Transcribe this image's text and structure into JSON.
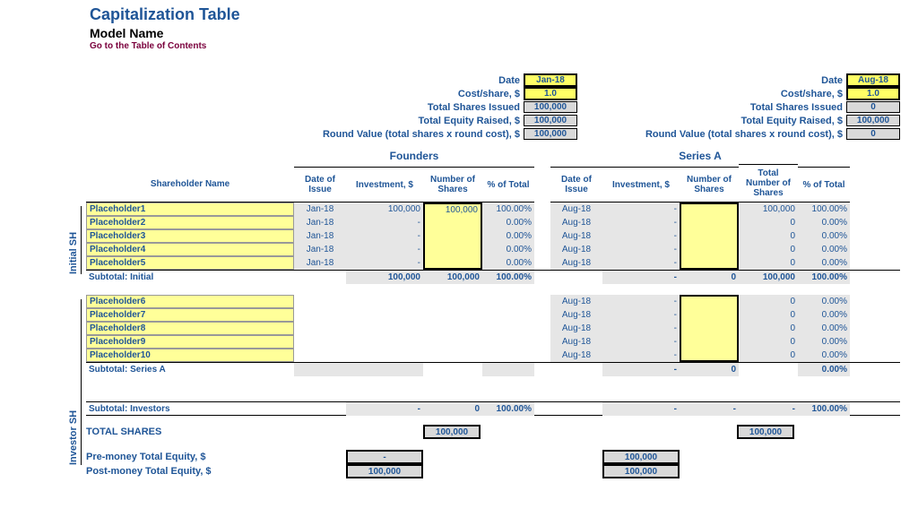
{
  "header": {
    "title": "Capitalization Table",
    "subtitle": "Model Name",
    "toc": "Go to the Table of Contents"
  },
  "vert": {
    "initial": "Initial SH",
    "investor": "Investor SH"
  },
  "labels": {
    "date": "Date",
    "cost": "Cost/share, $",
    "shares_issued": "Total Shares Issued",
    "equity_raised": "Total Equity Raised, $",
    "round_value": "Round Value (total shares x round cost), $",
    "shareholder": "Shareholder Name",
    "date_issue": "Date of Issue",
    "investment": "Investment, $",
    "num_shares": "Number of Shares",
    "pct_total": "% of Total",
    "total_num_shares": "Total Number of Shares",
    "founders": "Founders",
    "series_a": "Series A",
    "subtotal_initial": "Subtotal: Initial",
    "subtotal_seriesa": "Subtotal: Series A",
    "subtotal_investors": "Subtotal: Investors",
    "total_shares": "TOTAL SHARES",
    "premoney": "Pre-money Total Equity, $",
    "postmoney": "Post-money Total Equity, $"
  },
  "founders_summary": {
    "date": "Jan-18",
    "cost": "1.0",
    "shares": "100,000",
    "equity": "100,000",
    "round": "100,000"
  },
  "seriesa_summary": {
    "date": "Aug-18",
    "cost": "1.0",
    "shares": "0",
    "equity": "100,000",
    "round": "0"
  },
  "initial": [
    {
      "name": "Placeholder1",
      "f_date": "Jan-18",
      "f_inv": "100,000",
      "f_num": "100,000",
      "f_pct": "100.00%",
      "a_date": "Aug-18",
      "a_inv": "-",
      "a_num": "",
      "a_tot": "100,000",
      "a_pct": "100.00%"
    },
    {
      "name": "Placeholder2",
      "f_date": "Jan-18",
      "f_inv": "-",
      "f_num": "",
      "f_pct": "0.00%",
      "a_date": "Aug-18",
      "a_inv": "-",
      "a_num": "",
      "a_tot": "0",
      "a_pct": "0.00%"
    },
    {
      "name": "Placeholder3",
      "f_date": "Jan-18",
      "f_inv": "-",
      "f_num": "",
      "f_pct": "0.00%",
      "a_date": "Aug-18",
      "a_inv": "-",
      "a_num": "",
      "a_tot": "0",
      "a_pct": "0.00%"
    },
    {
      "name": "Placeholder4",
      "f_date": "Jan-18",
      "f_inv": "-",
      "f_num": "",
      "f_pct": "0.00%",
      "a_date": "Aug-18",
      "a_inv": "-",
      "a_num": "",
      "a_tot": "0",
      "a_pct": "0.00%"
    },
    {
      "name": "Placeholder5",
      "f_date": "Jan-18",
      "f_inv": "-",
      "f_num": "",
      "f_pct": "0.00%",
      "a_date": "Aug-18",
      "a_inv": "-",
      "a_num": "",
      "a_tot": "0",
      "a_pct": "0.00%"
    }
  ],
  "sub_initial": {
    "f_inv": "100,000",
    "f_num": "100,000",
    "f_pct": "100.00%",
    "a_inv": "-",
    "a_num": "0",
    "a_tot": "100,000",
    "a_pct": "100.00%"
  },
  "investors": [
    {
      "name": "Placeholder6",
      "a_date": "Aug-18",
      "a_inv": "-",
      "a_num": "",
      "a_tot": "0",
      "a_pct": "0.00%"
    },
    {
      "name": "Placeholder7",
      "a_date": "Aug-18",
      "a_inv": "-",
      "a_num": "",
      "a_tot": "0",
      "a_pct": "0.00%"
    },
    {
      "name": "Placeholder8",
      "a_date": "Aug-18",
      "a_inv": "-",
      "a_num": "",
      "a_tot": "0",
      "a_pct": "0.00%"
    },
    {
      "name": "Placeholder9",
      "a_date": "Aug-18",
      "a_inv": "-",
      "a_num": "",
      "a_tot": "0",
      "a_pct": "0.00%"
    },
    {
      "name": "Placeholder10",
      "a_date": "Aug-18",
      "a_inv": "-",
      "a_num": "",
      "a_tot": "0",
      "a_pct": "0.00%"
    }
  ],
  "sub_seriesa": {
    "a_inv": "-",
    "a_num": "0",
    "a_tot": "",
    "a_pct": "0.00%"
  },
  "sub_investors": {
    "f_inv": "-",
    "f_num": "0",
    "f_pct": "100.00%",
    "a_inv": "-",
    "a_num": "-",
    "a_tot": "-",
    "a_pct": "100.00%"
  },
  "totals": {
    "f_shares": "100,000",
    "a_shares": "100,000",
    "f_pre": "-",
    "f_post": "100,000",
    "a_pre": "100,000",
    "a_post": "100,000"
  }
}
